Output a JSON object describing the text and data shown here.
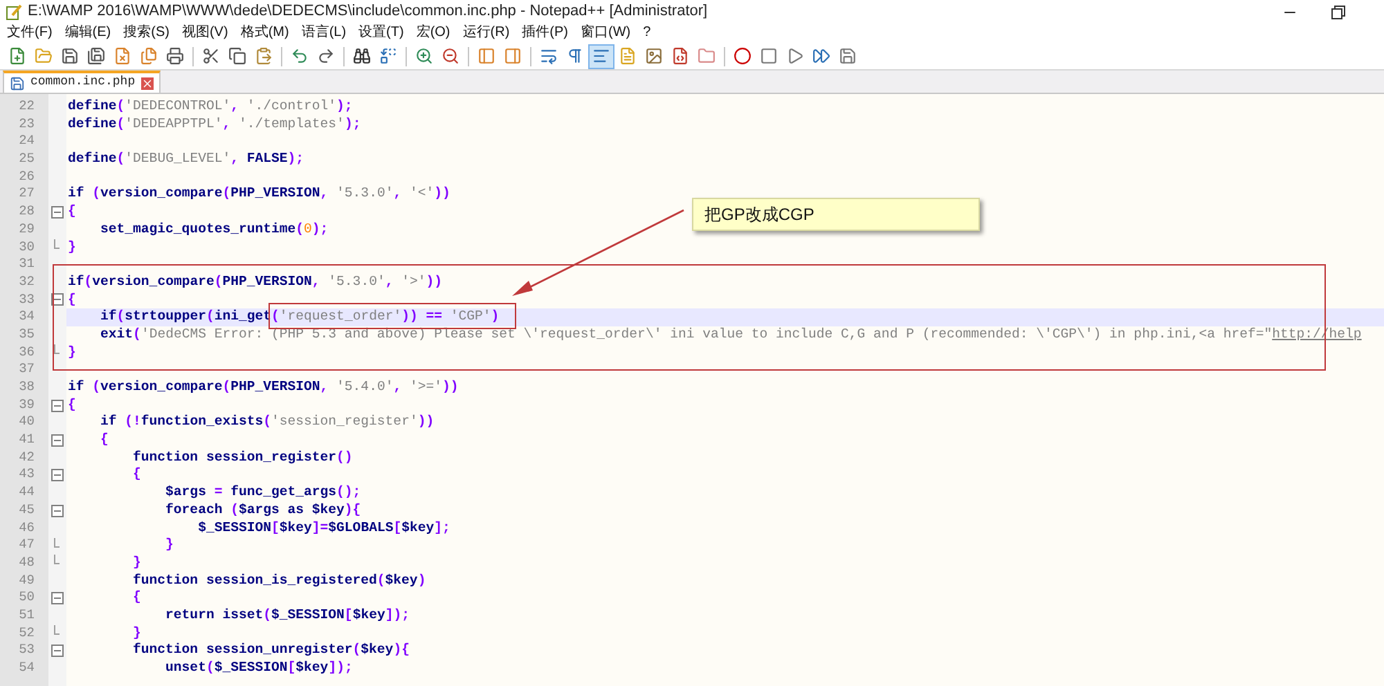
{
  "window": {
    "title": "E:\\WAMP 2016\\WAMP\\WWW\\dede\\DEDECMS\\include\\common.inc.php - Notepad++ [Administrator]"
  },
  "menu": [
    "文件(F)",
    "编辑(E)",
    "搜索(S)",
    "视图(V)",
    "格式(M)",
    "语言(L)",
    "设置(T)",
    "宏(O)",
    "运行(R)",
    "插件(P)",
    "窗口(W)",
    "?"
  ],
  "tabs": [
    {
      "label": "common.inc.php",
      "selected": true
    }
  ],
  "editor": {
    "lines": [
      {
        "number": "22",
        "kind": "plain",
        "current": false,
        "tokens": [
          {
            "kind": "word",
            "text": "define"
          },
          {
            "kind": "op",
            "text": "("
          },
          {
            "kind": "string",
            "text": "'DEDECONTROL'"
          },
          {
            "kind": "op",
            "text": ", "
          },
          {
            "kind": "string",
            "text": "'./control'"
          },
          {
            "kind": "op",
            "text": ");"
          }
        ]
      },
      {
        "number": "23",
        "kind": "plain",
        "current": false,
        "tokens": [
          {
            "kind": "word",
            "text": "define"
          },
          {
            "kind": "op",
            "text": "("
          },
          {
            "kind": "string",
            "text": "'DEDEAPPTPL'"
          },
          {
            "kind": "op",
            "text": ", "
          },
          {
            "kind": "string",
            "text": "'./templates'"
          },
          {
            "kind": "op",
            "text": ");"
          }
        ]
      },
      {
        "number": "24",
        "kind": "plain",
        "current": false
      },
      {
        "number": "25",
        "kind": "plain",
        "current": false,
        "tokens": [
          {
            "kind": "word",
            "text": "define"
          },
          {
            "kind": "op",
            "text": "("
          },
          {
            "kind": "string",
            "text": "'DEBUG_LEVEL'"
          },
          {
            "kind": "op",
            "text": ", "
          },
          {
            "kind": "word",
            "text": "FALSE"
          },
          {
            "kind": "op",
            "text": ");"
          }
        ]
      },
      {
        "number": "26",
        "kind": "plain",
        "current": false
      },
      {
        "number": "27",
        "kind": "plain",
        "current": false,
        "tokens": [
          {
            "kind": "word",
            "text": "if"
          },
          {
            "kind": "op",
            "text": " ("
          },
          {
            "kind": "word",
            "text": "version_compare"
          },
          {
            "kind": "op",
            "text": "("
          },
          {
            "kind": "word",
            "text": "PHP_VERSION"
          },
          {
            "kind": "op",
            "text": ", "
          },
          {
            "kind": "string",
            "text": "'5.3.0'"
          },
          {
            "kind": "op",
            "text": ", "
          },
          {
            "kind": "string",
            "text": "'<'"
          },
          {
            "kind": "op",
            "text": "))"
          }
        ]
      },
      {
        "number": "28",
        "kind": "foldstart",
        "current": false,
        "tokens": [
          {
            "kind": "op",
            "text": "{"
          }
        ]
      },
      {
        "number": "29",
        "kind": "plain",
        "current": false,
        "tokens": [
          {
            "kind": "word",
            "text": "    set_magic_quotes_runtime"
          },
          {
            "kind": "op",
            "text": "("
          },
          {
            "kind": "number",
            "text": "0"
          },
          {
            "kind": "op",
            "text": ");"
          }
        ]
      },
      {
        "number": "30",
        "kind": "foldend",
        "current": false,
        "tokens": [
          {
            "kind": "op",
            "text": "}"
          }
        ]
      },
      {
        "number": "31",
        "kind": "plain",
        "current": false
      },
      {
        "number": "32",
        "kind": "plain",
        "current": false,
        "tokens": [
          {
            "kind": "word",
            "text": "if"
          },
          {
            "kind": "op",
            "text": "("
          },
          {
            "kind": "word",
            "text": "version_compare"
          },
          {
            "kind": "op",
            "text": "("
          },
          {
            "kind": "word",
            "text": "PHP_VERSION"
          },
          {
            "kind": "op",
            "text": ", "
          },
          {
            "kind": "string",
            "text": "'5.3.0'"
          },
          {
            "kind": "op",
            "text": ", "
          },
          {
            "kind": "string",
            "text": "'>'"
          },
          {
            "kind": "op",
            "text": "))"
          }
        ]
      },
      {
        "number": "33",
        "kind": "foldstart",
        "current": false,
        "tokens": [
          {
            "kind": "op",
            "text": "{"
          }
        ]
      },
      {
        "number": "34",
        "kind": "plain",
        "current": true,
        "tokens": [
          {
            "kind": "word",
            "text": "    if"
          },
          {
            "kind": "op",
            "text": "("
          },
          {
            "kind": "word",
            "text": "strtoupper"
          },
          {
            "kind": "op",
            "text": "("
          },
          {
            "kind": "word",
            "text": "ini_get"
          },
          {
            "kind": "op",
            "text": "("
          },
          {
            "kind": "string",
            "text": "'request_order'"
          },
          {
            "kind": "op",
            "text": ")) == "
          },
          {
            "kind": "string",
            "text": "'CGP'"
          },
          {
            "kind": "op",
            "text": ")"
          }
        ]
      },
      {
        "number": "35",
        "kind": "plain",
        "current": false,
        "tokens": [
          {
            "kind": "word",
            "text": "    exit"
          },
          {
            "kind": "op",
            "text": "("
          },
          {
            "kind": "string",
            "text": "'DedeCMS Error: (PHP 5.3 and above) Please set \\'request_order\\' ini value to include C,G and P (recommended: \\'CGP\\') in php.ini,<a href=\""
          },
          {
            "kind": "link",
            "text": "http://help"
          }
        ]
      },
      {
        "number": "36",
        "kind": "foldend",
        "current": false,
        "tokens": [
          {
            "kind": "op",
            "text": "}"
          }
        ]
      },
      {
        "number": "37",
        "kind": "plain",
        "current": false
      },
      {
        "number": "38",
        "kind": "plain",
        "current": false,
        "tokens": [
          {
            "kind": "word",
            "text": "if"
          },
          {
            "kind": "op",
            "text": " ("
          },
          {
            "kind": "word",
            "text": "version_compare"
          },
          {
            "kind": "op",
            "text": "("
          },
          {
            "kind": "word",
            "text": "PHP_VERSION"
          },
          {
            "kind": "op",
            "text": ", "
          },
          {
            "kind": "string",
            "text": "'5.4.0'"
          },
          {
            "kind": "op",
            "text": ", "
          },
          {
            "kind": "string",
            "text": "'>='"
          },
          {
            "kind": "op",
            "text": "))"
          }
        ]
      },
      {
        "number": "39",
        "kind": "foldstart",
        "current": false,
        "tokens": [
          {
            "kind": "op",
            "text": "{"
          }
        ]
      },
      {
        "number": "40",
        "kind": "plain",
        "current": false,
        "tokens": [
          {
            "kind": "word",
            "text": "    if"
          },
          {
            "kind": "op",
            "text": " (!"
          },
          {
            "kind": "word",
            "text": "function_exists"
          },
          {
            "kind": "op",
            "text": "("
          },
          {
            "kind": "string",
            "text": "'session_register'"
          },
          {
            "kind": "op",
            "text": "))"
          }
        ]
      },
      {
        "number": "41",
        "kind": "foldstart",
        "current": false,
        "tokens": [
          {
            "kind": "op",
            "text": "    {"
          }
        ]
      },
      {
        "number": "42",
        "kind": "plain",
        "current": false,
        "tokens": [
          {
            "kind": "word",
            "text": "        function session_register"
          },
          {
            "kind": "op",
            "text": "()"
          }
        ]
      },
      {
        "number": "43",
        "kind": "foldstart",
        "current": false,
        "tokens": [
          {
            "kind": "op",
            "text": "        {"
          }
        ]
      },
      {
        "number": "44",
        "kind": "plain",
        "current": false,
        "tokens": [
          {
            "kind": "word",
            "text": "            $args"
          },
          {
            "kind": "op",
            "text": " = "
          },
          {
            "kind": "word",
            "text": "func_get_args"
          },
          {
            "kind": "op",
            "text": "();"
          }
        ]
      },
      {
        "number": "45",
        "kind": "foldstart",
        "current": false,
        "tokens": [
          {
            "kind": "word",
            "text": "            foreach"
          },
          {
            "kind": "op",
            "text": " ("
          },
          {
            "kind": "word",
            "text": "$args as $key"
          },
          {
            "kind": "op",
            "text": "){"
          }
        ]
      },
      {
        "number": "46",
        "kind": "plain",
        "current": false,
        "tokens": [
          {
            "kind": "word",
            "text": "                $_SESSION"
          },
          {
            "kind": "op",
            "text": "["
          },
          {
            "kind": "word",
            "text": "$key"
          },
          {
            "kind": "op",
            "text": "]="
          },
          {
            "kind": "word",
            "text": "$GLOBALS"
          },
          {
            "kind": "op",
            "text": "["
          },
          {
            "kind": "word",
            "text": "$key"
          },
          {
            "kind": "op",
            "text": "];"
          }
        ]
      },
      {
        "number": "47",
        "kind": "foldend",
        "current": false,
        "tokens": [
          {
            "kind": "op",
            "text": "            }"
          }
        ]
      },
      {
        "number": "48",
        "kind": "foldend",
        "current": false,
        "tokens": [
          {
            "kind": "op",
            "text": "        }"
          }
        ]
      },
      {
        "number": "49",
        "kind": "plain",
        "current": false,
        "tokens": [
          {
            "kind": "word",
            "text": "        function session_is_registered"
          },
          {
            "kind": "op",
            "text": "("
          },
          {
            "kind": "word",
            "text": "$key"
          },
          {
            "kind": "op",
            "text": ")"
          }
        ]
      },
      {
        "number": "50",
        "kind": "foldstart",
        "current": false,
        "tokens": [
          {
            "kind": "op",
            "text": "        {"
          }
        ]
      },
      {
        "number": "51",
        "kind": "plain",
        "current": false,
        "tokens": [
          {
            "kind": "word",
            "text": "            return isset"
          },
          {
            "kind": "op",
            "text": "("
          },
          {
            "kind": "word",
            "text": "$_SESSION"
          },
          {
            "kind": "op",
            "text": "["
          },
          {
            "kind": "word",
            "text": "$key"
          },
          {
            "kind": "op",
            "text": "]);"
          }
        ]
      },
      {
        "number": "52",
        "kind": "foldend",
        "current": false,
        "tokens": [
          {
            "kind": "op",
            "text": "        }"
          }
        ]
      },
      {
        "number": "53",
        "kind": "foldstart",
        "current": false,
        "tokens": [
          {
            "kind": "word",
            "text": "        function session_unregister"
          },
          {
            "kind": "op",
            "text": "("
          },
          {
            "kind": "word",
            "text": "$key"
          },
          {
            "kind": "op",
            "text": "){"
          }
        ]
      },
      {
        "number": "54",
        "kind": "plain",
        "current": false,
        "tokens": [
          {
            "kind": "word",
            "text": "            unset"
          },
          {
            "kind": "op",
            "text": "("
          },
          {
            "kind": "word",
            "text": "$_SESSION"
          },
          {
            "kind": "op",
            "text": "["
          },
          {
            "kind": "word",
            "text": "$key"
          },
          {
            "kind": "op",
            "text": "]);"
          }
        ]
      }
    ]
  },
  "annotation": {
    "callout": "把GP改成CGP"
  }
}
